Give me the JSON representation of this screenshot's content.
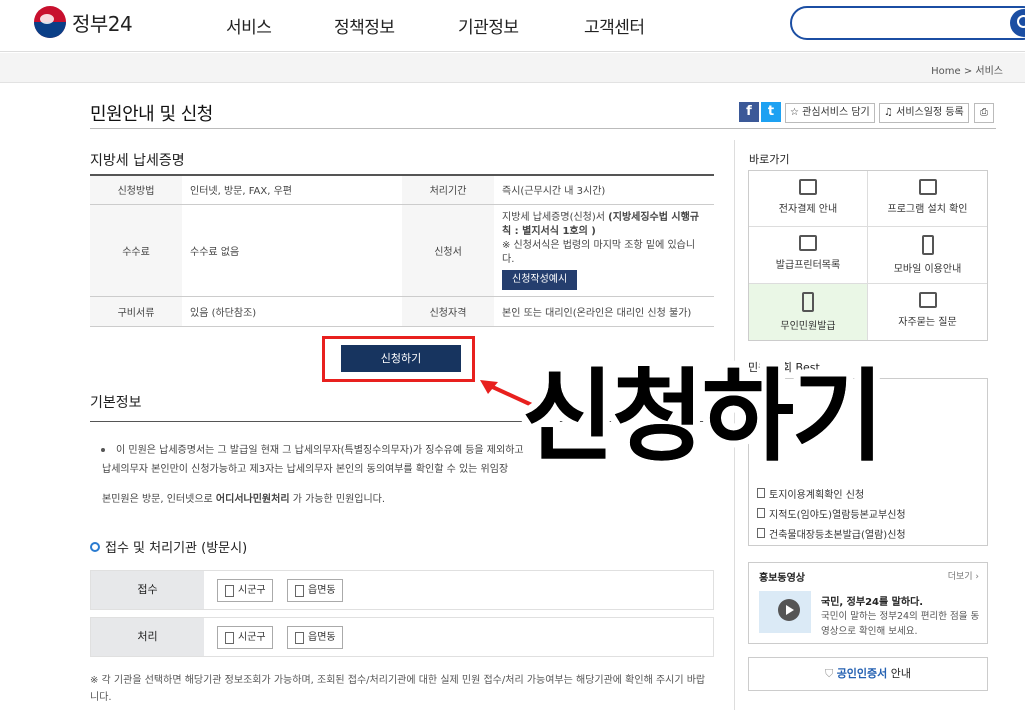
{
  "header": {
    "logo_text": "정부24",
    "nav": [
      "서비스",
      "정책정보",
      "기관정보",
      "고객센터"
    ]
  },
  "breadcrumb": {
    "home": "Home",
    "sep": ">",
    "current": "서비스"
  },
  "page": {
    "title": "민원안내 및 신청",
    "actions": {
      "favorite": "관심서비스 담기",
      "schedule": "서비스일정 등록"
    }
  },
  "service": {
    "name": "지방세 납세증명",
    "rows": {
      "method_label": "신청방법",
      "method_value": "인터넷, 방문, FAX, 우편",
      "period_label": "처리기간",
      "period_value": "즉시(근무시간 내 3시간)",
      "fee_label": "수수료",
      "fee_value": "수수료 없음",
      "form_label": "신청서",
      "form_value_1": "지방세 납세증명(신청)서",
      "form_value_bold": "(지방세징수법 시행규칙 : 별지서식 1호의 )",
      "form_note": "※ 신청서식은 법령의 마지막 조항 밑에 있습니다.",
      "form_sample": "신청작성예시",
      "docs_label": "구비서류",
      "docs_value": "있음 (하단참조)",
      "qual_label": "신청자격",
      "qual_value": "본인 또는 대리인(온라인은 대리인 신청 불가)"
    },
    "apply_button": "신청하기"
  },
  "basic_info": {
    "heading": "기본정보",
    "bullet_line1": "이 민원은 납세증명서는 그 발급일 현재 그 납세의무자(특별징수의무자)가 징수유예 등을 제외하고",
    "bullet_line2": "납세의무자 본인만이 신청가능하고 제3자는 납세의무자 본인의 동의여부를 확인할 수 있는 위임장",
    "sub_prefix": "본민원은 방문, 인터넷으로 ",
    "sub_bold": "어디서나민원처리",
    "sub_suffix": " 가 가능한 민원입니다."
  },
  "processing": {
    "heading": "접수 및 처리기관 (방문시)",
    "receipt_label": "접수",
    "process_label": "처리",
    "btn_city": "시군구",
    "btn_town": "읍면동",
    "notice": "※ 각 기관을 선택하면 해당기관 정보조회가 가능하며, 조회된 접수/처리기관에 대한 실제 민원 접수/처리 가능여부는 해당기관에 확인해 주시기 바랍니다."
  },
  "sidebar": {
    "quick_title": "바로가기",
    "quick": [
      "전자결제 안내",
      "프로그램 설치 확인",
      "발급프린터목록",
      "모바일 이용안내",
      "무인민원발급",
      "자주묻는 질문"
    ],
    "best_title": "민원 조회 Best",
    "best_items": [
      "토지이용계획확인 신청",
      "지적도(임야도)열람등본교부신청",
      "건축물대장등초본발급(열람)신청"
    ],
    "promo_title": "홍보동영상",
    "promo_more": "더보기 ›",
    "promo_head": "국민, 정부24를 말하다.",
    "promo_desc": "국민이 말하는 정부24의 편리한 점을 동영상으로 확인해 보세요.",
    "cert_blue": "공인인증서",
    "cert_rest": " 안내"
  },
  "overlay": {
    "caption": "신청하기"
  },
  "colors": {
    "accent": "#17345f",
    "highlight": "#e8201e",
    "brand_blue": "#1b4ea3"
  }
}
